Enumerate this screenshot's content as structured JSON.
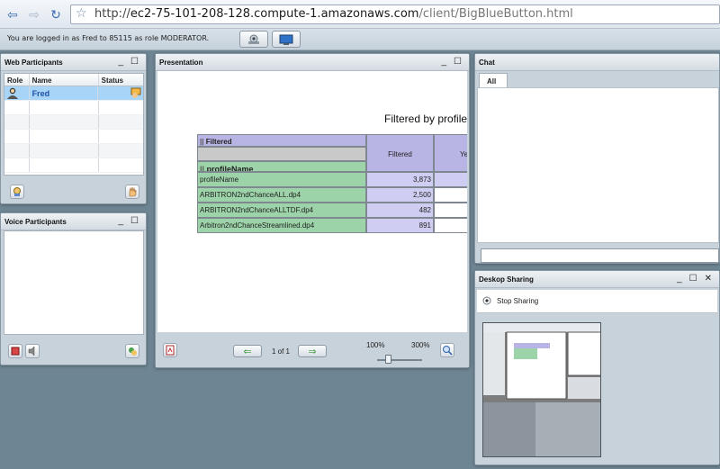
{
  "browser": {
    "back_icon": "back-arrow-icon",
    "forward_icon": "forward-arrow-icon",
    "reload_icon": "reload-icon",
    "bookmark_icon": "star-icon",
    "url_prefix": "http://",
    "url_host": "ec2-75-101-208-128.compute-1.amazonaws.com",
    "url_path": "/client/BigBlueButton.html"
  },
  "app_bar": {
    "login_text": "You are logged in as Fred to 85115 as role MODERATOR.",
    "webcam_icon": "webcam-icon",
    "desktop_icon": "monitor-icon"
  },
  "web_participants": {
    "title": "Web Participants",
    "columns": [
      "Role",
      "Name",
      "Status"
    ],
    "rows": [
      {
        "role_icon": "moderator-icon",
        "name": "Fred",
        "status_icon": "presenter-icon"
      }
    ]
  },
  "voice_participants": {
    "title": "Voice Participants"
  },
  "presentation": {
    "title": "Presentation",
    "slide_title": "Filtered by profile",
    "pivot": {
      "header_filtered": "Filtered",
      "header_profile": "profileName",
      "col_filtered": "Filtered",
      "col_yes": "Ye",
      "rows": [
        {
          "label": "profileName",
          "value": "3,873"
        },
        {
          "label": "ARBITRON2ndChanceALL.dp4",
          "value": "2,500"
        },
        {
          "label": "ARBITRON2ndChanceALLTDF.dp4",
          "value": "482"
        },
        {
          "label": "Arbitron2ndChanceStreamlined.dp4",
          "value": "891"
        }
      ]
    },
    "page_indicator": "1 of 1",
    "zoom_min": "100%",
    "zoom_max": "300%",
    "zoom_level": 0.25
  },
  "chat": {
    "title": "Chat",
    "tab_all": "All"
  },
  "desktop_sharing": {
    "title": "Deskop Sharing",
    "stop_label": "Stop Sharing"
  },
  "panel_controls": {
    "minimize": "_",
    "maximize": "☐",
    "close": "✕"
  }
}
